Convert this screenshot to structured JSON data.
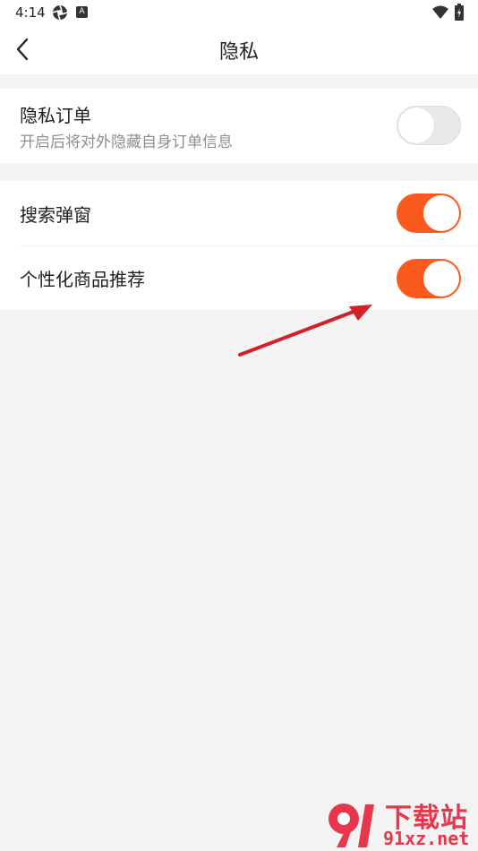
{
  "status_bar": {
    "time": "4:14",
    "badge": "A"
  },
  "header": {
    "title": "隐私"
  },
  "privacy_order": {
    "title": "隐私订单",
    "description": "开启后将对外隐藏自身订单信息",
    "enabled": false
  },
  "settings": {
    "search_popup": {
      "label": "搜索弹窗",
      "enabled": true
    },
    "personalized": {
      "label": "个性化商品推荐",
      "enabled": true
    }
  },
  "watermark": {
    "logo_text": "91",
    "line1": "下载站",
    "line2": "91xz.net"
  },
  "colors": {
    "accent": "#fb5a1f",
    "toggle_off": "#e9e9eb",
    "background": "#f4f4f4",
    "annotation_arrow": "#d3202a",
    "watermark": "#e8374c"
  }
}
